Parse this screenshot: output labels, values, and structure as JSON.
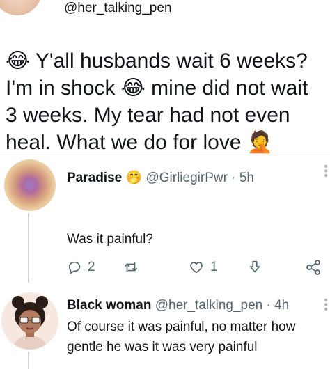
{
  "top": {
    "handle": "@her_talking_pen"
  },
  "tweet": {
    "line1_text": "Y'all husbands wait 6 weeks?",
    "line2_part1": "I'm in shock ",
    "line2_part2": " mine did not wait",
    "line3": "3 weeks. My tear had not even",
    "line4_text": "heal. What we do for love ",
    "emoji_laughing": "😂",
    "emoji_facepalm": "🤦"
  },
  "reply1": {
    "name": "Paradise",
    "name_emoji": "🤭",
    "handle_time": "@GirliegirPwr · 5h",
    "text": "Was it painful?",
    "reply_count": "2",
    "like_count": "1"
  },
  "reply2": {
    "name": "Black woman",
    "handle_time": "@her_talking_pen · 4h",
    "text": "Of course it was painful, no matter how gentle he was it was very painful"
  },
  "icons": {
    "reply": "reply-icon",
    "retweet": "retweet-icon",
    "like": "heart-icon",
    "bookmark": "bookmark-icon",
    "share": "share-icon",
    "more": "more-icon"
  },
  "colors": {
    "text": "#0f1419",
    "muted": "#536471",
    "divider": "#eff3f4"
  }
}
